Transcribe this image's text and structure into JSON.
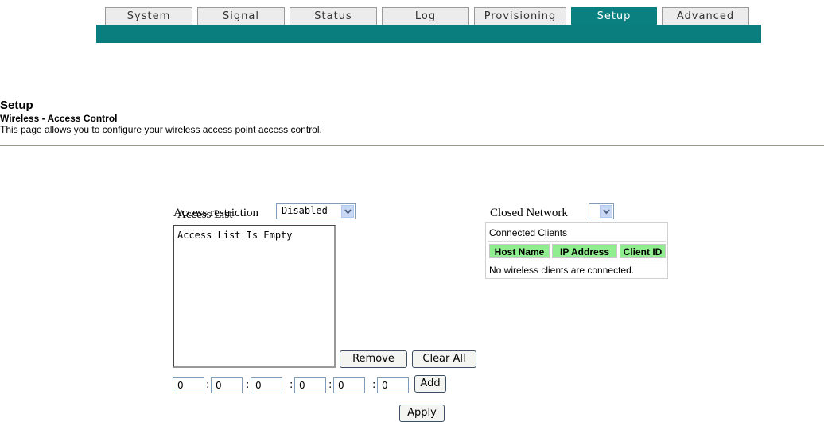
{
  "tabs": [
    {
      "label": "System",
      "active": false
    },
    {
      "label": "Signal",
      "active": false
    },
    {
      "label": "Status",
      "active": false
    },
    {
      "label": "Log",
      "active": false
    },
    {
      "label": "Provisioning",
      "active": false
    },
    {
      "label": "Setup",
      "active": true
    },
    {
      "label": "Advanced",
      "active": false
    }
  ],
  "header": {
    "title": "Setup",
    "subtitle": "Wireless - Access Control",
    "description": "This page allows you to configure your wireless access point access control."
  },
  "access_restriction": {
    "label": "Access restriction",
    "value": "Disabled"
  },
  "closed_network": {
    "label": "Closed Network",
    "value": ""
  },
  "access_list": {
    "label": "Access List",
    "items": [
      "Access List Is Empty"
    ]
  },
  "buttons": {
    "remove": "Remove",
    "clear_all": "Clear All",
    "add": "Add",
    "apply": "Apply"
  },
  "mac_fields": [
    "0",
    "0",
    "0",
    "0",
    "0",
    "0"
  ],
  "mac_separator": ":",
  "connected_clients": {
    "title": "Connected Clients",
    "columns": [
      "Host Name",
      "IP Address",
      "Client ID"
    ],
    "empty_message": "No wireless clients are connected."
  },
  "colors": {
    "tab_bar": "#0a7d7e",
    "table_header": "#90ee90"
  }
}
